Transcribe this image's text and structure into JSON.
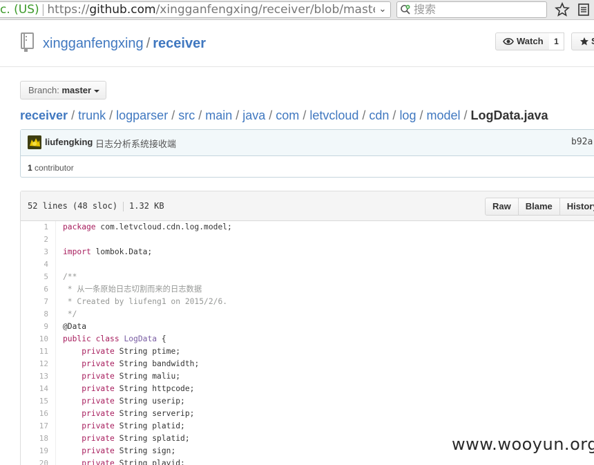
{
  "browser": {
    "identity": "c. (US)",
    "url_scheme": "https://",
    "url_host": "github.com",
    "url_path": "/xingganfengxing/receiver/blob/master/t",
    "search_placeholder": "搜索"
  },
  "repo": {
    "owner": "xingganfengxing",
    "separator": "/",
    "name": "receiver",
    "watch_label": "Watch",
    "watch_count": "1",
    "star_label": "S"
  },
  "branch": {
    "label": "Branch:",
    "name": "master"
  },
  "breadcrumb": {
    "root": "receiver",
    "parts": [
      "trunk",
      "logparser",
      "src",
      "main",
      "java",
      "com",
      "letvcloud",
      "cdn",
      "log",
      "model"
    ],
    "file": "LogData.java"
  },
  "commit": {
    "author": "liufengking",
    "message": "日志分析系统接收端",
    "sha": "b92a",
    "contributors_count": "1",
    "contributors_label": "contributor"
  },
  "file": {
    "lines_info": "52 lines (48 sloc)",
    "size": "1.32 KB",
    "buttons": [
      "Raw",
      "Blame",
      "History"
    ]
  },
  "code_lines": [
    {
      "n": "1",
      "t": "package com.letvcloud.cdn.log.model;"
    },
    {
      "n": "2",
      "t": ""
    },
    {
      "n": "3",
      "t": "import lombok.Data;"
    },
    {
      "n": "4",
      "t": ""
    },
    {
      "n": "5",
      "t": "/**"
    },
    {
      "n": "6",
      "t": " * 从一条原始日志切割而来的日志数据"
    },
    {
      "n": "7",
      "t": " * Created by liufeng1 on 2015/2/6."
    },
    {
      "n": "8",
      "t": " */"
    },
    {
      "n": "9",
      "t": "@Data"
    },
    {
      "n": "10",
      "t": "public class LogData {"
    },
    {
      "n": "11",
      "t": "    private String ptime;"
    },
    {
      "n": "12",
      "t": "    private String bandwidth;"
    },
    {
      "n": "13",
      "t": "    private String maliu;"
    },
    {
      "n": "14",
      "t": "    private String httpcode;"
    },
    {
      "n": "15",
      "t": "    private String userip;"
    },
    {
      "n": "16",
      "t": "    private String serverip;"
    },
    {
      "n": "17",
      "t": "    private String platid;"
    },
    {
      "n": "18",
      "t": "    private String splatid;"
    },
    {
      "n": "19",
      "t": "    private String sign;"
    },
    {
      "n": "20",
      "t": "    private String playid;"
    }
  ],
  "watermark": "www.wooyun.org"
}
